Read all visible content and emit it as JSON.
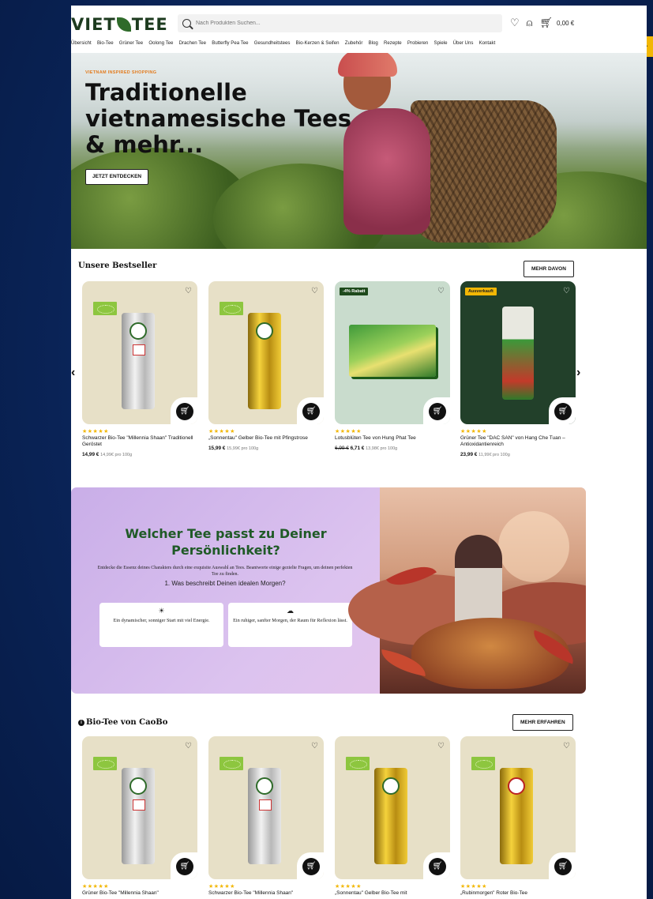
{
  "header": {
    "logo": "VIET TEE",
    "search_placeholder": "Nach Produkten Suchen...",
    "cart_total": "0,00 €"
  },
  "nav": [
    "Übersicht",
    "Bio-Tee",
    "Grüner Tee",
    "Oolong Tee",
    "Drachen Tee",
    "Butterfly Pea Tee",
    "Gesundheitstees",
    "Bio-Kerzen & Seifen",
    "Zubehör",
    "Blog",
    "Rezepte",
    "Probieren",
    "Spiele",
    "Über Uns",
    "Kontakt"
  ],
  "hero": {
    "kicker": "VIETNAM INSPIRED SHOPPING",
    "title": "Traditionelle vietnamesische Tees & mehr...",
    "cta": "JETZT ENTDECKEN"
  },
  "bestseller": {
    "title": "Unsere Bestseller",
    "more": "MEHR DAVON",
    "products": [
      {
        "name": "Schwarzer Bio-Tee \"Millennia Shaan\" Traditionell Geröstet",
        "price": "14,99 €",
        "unit": "14,99€ pro 100g",
        "old": "",
        "badge": "",
        "stars": "★★★★★"
      },
      {
        "name": "„Sonnentau\" Gelber Bio-Tee mit Pfingstrose",
        "price": "15,99 €",
        "unit": "15,99€ pro 100g",
        "old": "",
        "badge": "",
        "stars": "★★★★★"
      },
      {
        "name": "Lotusblüten Tee von Hung Phat Tee",
        "price": "6,71 €",
        "unit": "13,98€ pro 100g",
        "old": "6,99 €",
        "badge": "-4% Rabatt",
        "stars": "★★★★★"
      },
      {
        "name": "Grüner Tee \"DAC SAN\" von Hang Che Tuan – Antioxidantienreich",
        "price": "23,99 €",
        "unit": "11,99€ pro 100g",
        "old": "",
        "badge": "Ausverkauft",
        "stars": "★★★★★"
      }
    ]
  },
  "quiz": {
    "title": "Welcher Tee passt zu Deiner Persönlichkeit?",
    "intro": "Entdecke die Essenz deines Charakters durch eine exquisite Auswahl an Tees. Beantworte einige gezielte Fragen, um deinen perfekten Tee zu finden.",
    "question": "1. Was beschreibt Deinen idealen Morgen?",
    "options": [
      {
        "icon": "☀",
        "text": "Ein dynamischer, sonniger Start mit viel Energie."
      },
      {
        "icon": "☁",
        "text": "Ein ruhiger, sanfter Morgen, der Raum für Reflexion lässt."
      }
    ]
  },
  "bio": {
    "title": "Bio-Tee von CaoBo",
    "more": "MEHR ERFAHREN",
    "products": [
      {
        "name": "Grüner Bio-Tee \"Millennia Shaan\"",
        "stars": "★★★★★"
      },
      {
        "name": "Schwarzer Bio-Tee \"Millennia Shaan\"",
        "stars": "★★★★★"
      },
      {
        "name": "„Sonnentau\" Gelber Bio-Tee mit",
        "stars": "★★★★★"
      },
      {
        "name": "„Rubinmorgen\" Roter Bio-Tee",
        "stars": "★★★★★"
      }
    ]
  },
  "colors": {
    "accent_green": "#1f5a26",
    "star": "#f2b705",
    "kicker": "#e27b1e"
  }
}
